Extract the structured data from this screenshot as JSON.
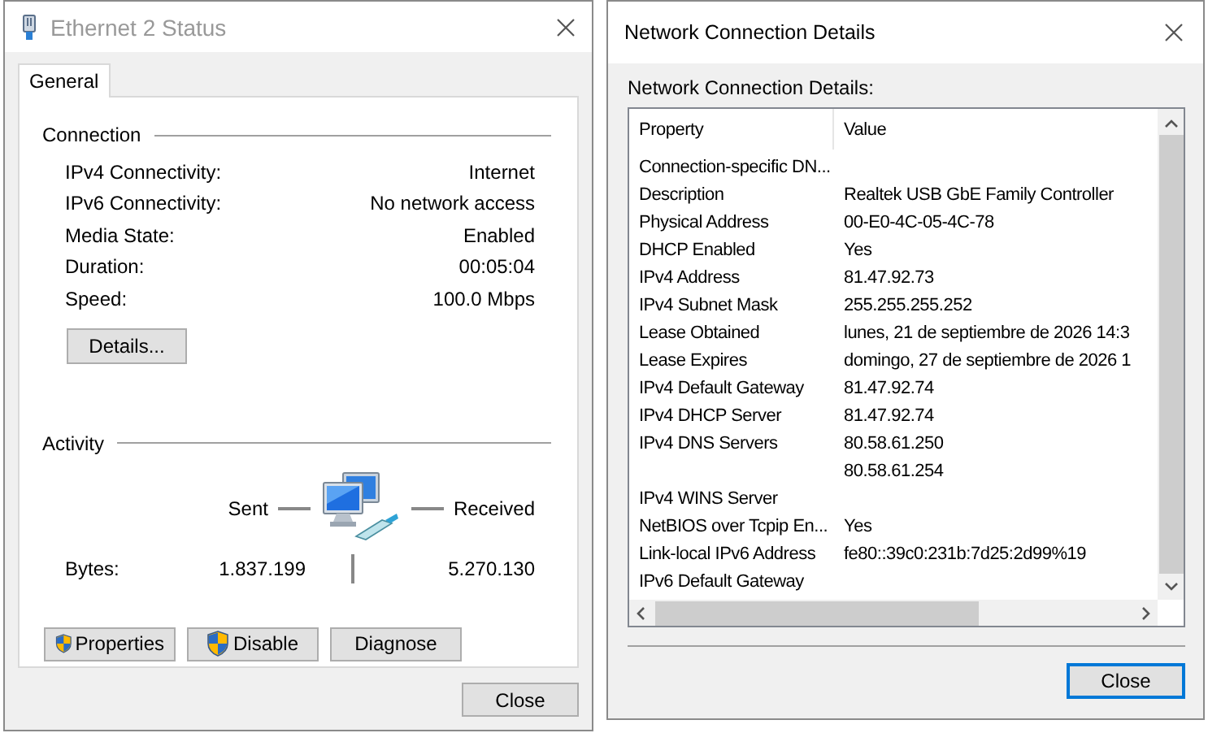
{
  "status_window": {
    "title": "Ethernet 2 Status",
    "tabs": [
      {
        "label": "General",
        "selected": true
      }
    ],
    "connection": {
      "heading": "Connection",
      "fields": [
        {
          "label": "IPv4 Connectivity:",
          "value": "Internet"
        },
        {
          "label": "IPv6 Connectivity:",
          "value": "No network access"
        },
        {
          "label": "Media State:",
          "value": "Enabled"
        },
        {
          "label": "Duration:",
          "value": "00:05:04"
        },
        {
          "label": "Speed:",
          "value": "100.0 Mbps"
        }
      ],
      "details_button": "Details..."
    },
    "activity": {
      "heading": "Activity",
      "sent_label": "Sent",
      "received_label": "Received",
      "bytes_label": "Bytes:",
      "sent": "1.837.199",
      "received": "5.270.130"
    },
    "buttons": [
      {
        "label": "Properties",
        "shield": true
      },
      {
        "label": "Disable",
        "shield": true
      },
      {
        "label": "Diagnose",
        "shield": false
      }
    ],
    "close_button": {
      "label": "Close",
      "focused": false
    }
  },
  "details_window": {
    "title": "Network Connection Details",
    "caption": "Network Connection Details:",
    "columns": [
      "Property",
      "Value"
    ],
    "rows": [
      {
        "property": "Connection-specific DN..."
      },
      {
        "property": "Description",
        "value": "Realtek USB GbE Family Controller"
      },
      {
        "property": "Physical Address",
        "value": "00-E0-4C-05-4C-78"
      },
      {
        "property": "DHCP Enabled",
        "value": "Yes"
      },
      {
        "property": "IPv4 Address",
        "value": "81.47.92.73"
      },
      {
        "property": "IPv4 Subnet Mask",
        "value": "255.255.255.252"
      },
      {
        "property": "Lease Obtained",
        "value": "lunes, 21 de septiembre de 2026 14:3"
      },
      {
        "property": "Lease Expires",
        "value": "domingo, 27 de septiembre de 2026 1"
      },
      {
        "property": "IPv4 Default Gateway",
        "value": "81.47.92.74"
      },
      {
        "property": "IPv4 DHCP Server",
        "value": "81.47.92.74"
      },
      {
        "property": "IPv4 DNS Servers",
        "value": "80.58.61.250"
      },
      {
        "value": "80.58.61.254"
      },
      {
        "property": "IPv4 WINS Server"
      },
      {
        "property": "NetBIOS over Tcpip En...",
        "value": "Yes"
      },
      {
        "property": "Link-local IPv6 Address",
        "value": "fe80::39c0:231b:7d25:2d99%19"
      },
      {
        "property": "IPv6 Default Gateway"
      }
    ],
    "close_button": {
      "label": "Close",
      "focused": true
    }
  }
}
